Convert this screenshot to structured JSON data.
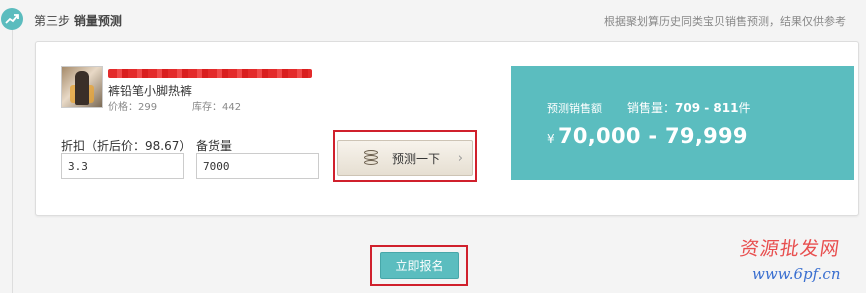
{
  "step": {
    "title_prefix": "第三步",
    "title_main": "销量预测",
    "hint": "根据聚划算历史同类宝贝销售预测，结果仅供参考"
  },
  "product": {
    "name": "裤铅笔小脚热裤",
    "price_label": "价格：299",
    "stock_label": "库存：442"
  },
  "form": {
    "discount_label": "折扣（折后价：98.67）",
    "discount_value": "3.3",
    "stock_label": "备货量",
    "stock_value": "7000"
  },
  "predict_button": {
    "label": "预测一下"
  },
  "result": {
    "amount_title": "预测销售额",
    "volume_prefix": "销售量：",
    "volume_range": "709 - 811",
    "volume_unit": "件",
    "currency": "¥",
    "amount_range": "70,000 - 79,999"
  },
  "apply_button": {
    "label": "立即报名"
  },
  "watermark": {
    "line1": "资源批发网",
    "line2": "www.6pf.cn"
  },
  "colors": {
    "accent": "#5bbdbf",
    "highlight_box": "#d0202c"
  },
  "icons": [
    "trend-up-icon",
    "coins-icon",
    "chevron-right-icon"
  ]
}
